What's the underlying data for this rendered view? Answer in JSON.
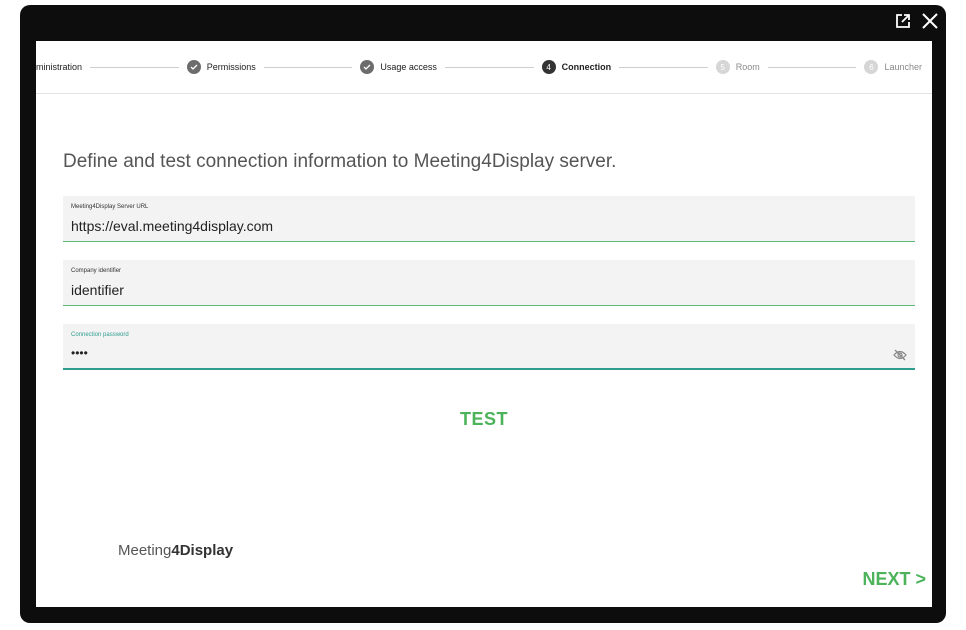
{
  "window": {
    "icons": [
      "open-external-icon",
      "close-icon"
    ]
  },
  "stepper": {
    "steps": [
      {
        "label": "ministration",
        "state": "partial",
        "number": ""
      },
      {
        "label": "Permissions",
        "state": "done",
        "number": ""
      },
      {
        "label": "Usage access",
        "state": "done",
        "number": ""
      },
      {
        "label": "Connection",
        "state": "active",
        "number": "4"
      },
      {
        "label": "Room",
        "state": "future",
        "number": "5"
      },
      {
        "label": "Launcher",
        "state": "future",
        "number": "6"
      }
    ]
  },
  "main": {
    "heading": "Define and test connection information to Meeting4Display server.",
    "server_url": {
      "label": "Meeting4Display Server URL",
      "value": "https://eval.meeting4display.com"
    },
    "company": {
      "label": "Company identifier",
      "value": "identifier"
    },
    "password": {
      "label": "Connection password",
      "value": "••••"
    },
    "test_label": "TEST",
    "next_label": "NEXT >"
  },
  "logo": {
    "part1": "Meeting",
    "part2": "4Display"
  },
  "colors": {
    "accent": "#4cb35a",
    "focus": "#2e9e8f",
    "frame": "#0d0d0d"
  }
}
